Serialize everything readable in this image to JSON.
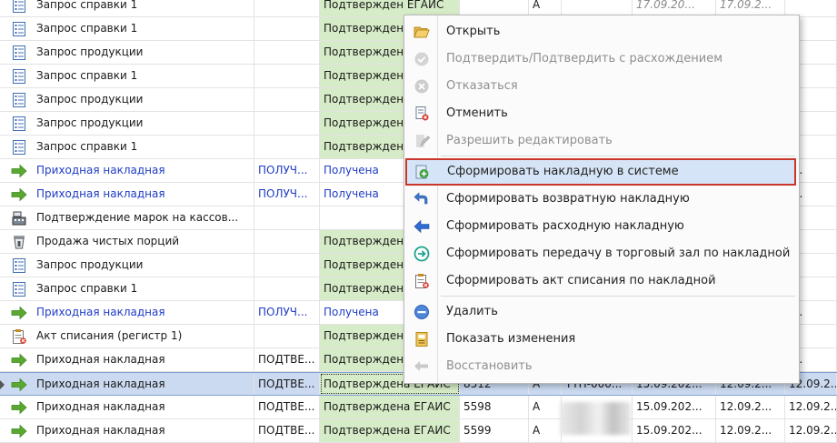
{
  "grid": {
    "rows": [
      {
        "name": "Запрос справки 1",
        "icon": "list-document-icon",
        "blue": false,
        "col_a": "",
        "status": "Подтвержден ЕГАИС",
        "status_green": true,
        "num": "",
        "b": "A",
        "c": "",
        "d1": "17.09.20...",
        "d2": "17.09.2...",
        "d3": "",
        "italic_d1": true
      },
      {
        "name": "Запрос справки 1",
        "icon": "list-document-icon",
        "blue": false,
        "col_a": "",
        "status": "Подтвержден",
        "status_green": true,
        "num": "",
        "b": "",
        "c": "",
        "d1": "",
        "d2": "",
        "d3": ""
      },
      {
        "name": "Запрос продукции",
        "icon": "list-document-icon",
        "blue": false,
        "col_a": "",
        "status": "Подтвержден",
        "status_green": true,
        "num": "",
        "b": "",
        "c": "",
        "d1": "",
        "d2": "",
        "d3": ""
      },
      {
        "name": "Запрос справки 1",
        "icon": "list-document-icon",
        "blue": false,
        "col_a": "",
        "status": "Подтвержден",
        "status_green": true,
        "num": "",
        "b": "",
        "c": "",
        "d1": "",
        "d2": "",
        "d3": ""
      },
      {
        "name": "Запрос продукции",
        "icon": "list-document-icon",
        "blue": false,
        "col_a": "",
        "status": "Подтвержден",
        "status_green": true,
        "num": "",
        "b": "",
        "c": "",
        "d1": "",
        "d2": "",
        "d3": ""
      },
      {
        "name": "Запрос продукции",
        "icon": "list-document-icon",
        "blue": false,
        "col_a": "",
        "status": "Подтвержден",
        "status_green": true,
        "num": "",
        "b": "",
        "c": "",
        "d1": "",
        "d2": "",
        "d3": ""
      },
      {
        "name": "Запрос справки 1",
        "icon": "list-document-icon",
        "blue": false,
        "col_a": "",
        "status": "Подтвержден",
        "status_green": true,
        "num": "",
        "b": "",
        "c": "",
        "d1": "",
        "d2": "",
        "d3": ""
      },
      {
        "name": "Приходная накладная",
        "icon": "green-arrow-icon",
        "blue": true,
        "col_a": "ПОЛУЧ...",
        "status": "Получена",
        "status_green": false,
        "num": "",
        "b": "",
        "c": "",
        "d1": "",
        "d2": "",
        "d3": ".2."
      },
      {
        "name": "Приходная накладная",
        "icon": "green-arrow-icon",
        "blue": true,
        "col_a": "ПОЛУЧ...",
        "status": "Получена",
        "status_green": false,
        "num": "",
        "b": "",
        "c": "",
        "d1": "",
        "d2": "",
        "d3": ".2."
      },
      {
        "name": "Подтверждение марок на кассов...",
        "icon": "cash-register-icon",
        "blue": false,
        "col_a": "",
        "status": "",
        "status_green": false,
        "num": "",
        "b": "",
        "c": "",
        "d1": "",
        "d2": "",
        "d3": ""
      },
      {
        "name": "Продажа чистых порций",
        "icon": "glass-icon",
        "blue": false,
        "col_a": "",
        "status": "Подтвержден",
        "status_green": true,
        "num": "",
        "b": "",
        "c": "",
        "d1": "",
        "d2": "",
        "d3": ""
      },
      {
        "name": "Запрос продукции",
        "icon": "list-document-icon",
        "blue": false,
        "col_a": "",
        "status": "Подтвержден",
        "status_green": true,
        "num": "",
        "b": "",
        "c": "",
        "d1": "",
        "d2": "",
        "d3": ""
      },
      {
        "name": "Запрос справки 1",
        "icon": "list-document-icon",
        "blue": false,
        "col_a": "",
        "status": "Подтвержден",
        "status_green": true,
        "num": "",
        "b": "",
        "c": "",
        "d1": "",
        "d2": "",
        "d3": ""
      },
      {
        "name": "Приходная накладная",
        "icon": "green-arrow-icon",
        "blue": true,
        "col_a": "ПОЛУЧ...",
        "status": "Получена",
        "status_green": false,
        "num": "",
        "b": "",
        "c": "",
        "d1": "",
        "d2": "",
        "d3": ".2."
      },
      {
        "name": "Акт списания (регистр 1)",
        "icon": "write-off-act-icon",
        "blue": false,
        "col_a": "",
        "status": "Подтвержден",
        "status_green": true,
        "num": "",
        "b": "",
        "c": "",
        "d1": "",
        "d2": "",
        "d3": ""
      },
      {
        "name": "Приходная накладная",
        "icon": "green-arrow-icon",
        "blue": false,
        "col_a": "ПОДТВЕ...",
        "status": "Подтвержден",
        "status_green": true,
        "num": "",
        "b": "",
        "c": "",
        "d1": "",
        "d2": "",
        "d3": ".2."
      },
      {
        "name": "Приходная накладная",
        "icon": "green-arrow-icon",
        "blue": false,
        "col_a": "ПОДТВЕ...",
        "status": "Подтверждена ЕГАИС",
        "status_green": true,
        "num": "8512",
        "b": "A",
        "c": "ТТН-000...",
        "d1": "15.09.202...",
        "d2": "12.09.2...",
        "d3": "12.09.2...",
        "selected": true
      },
      {
        "name": "Приходная накладная",
        "icon": "green-arrow-icon",
        "blue": false,
        "col_a": "ПОДТВЕ...",
        "status": "Подтверждена ЕГАИС",
        "status_green": true,
        "num": "5598",
        "b": "A",
        "c": "",
        "d1": "15.09.202...",
        "d2": "12.09.2...",
        "d3": "12.09.2..."
      },
      {
        "name": "Приходная накладная",
        "icon": "green-arrow-icon",
        "blue": false,
        "col_a": "ПОДТВЕ...",
        "status": "Подтверждена ЕГАИС",
        "status_green": true,
        "num": "5599",
        "b": "A",
        "c": "",
        "d1": "15.09.202...",
        "d2": "12.09.2...",
        "d3": "12.09.2..."
      }
    ]
  },
  "context_menu": {
    "items": [
      {
        "label": "Открыть",
        "icon": "folder-open-icon",
        "enabled": true,
        "highlight": false
      },
      {
        "label": "Подтвердить/Подтвердить с расхождением",
        "icon": "check-circle-icon",
        "enabled": false,
        "highlight": false
      },
      {
        "label": "Отказаться",
        "icon": "cancel-circle-icon",
        "enabled": false,
        "highlight": false
      },
      {
        "label": "Отменить",
        "icon": "cancel-document-icon",
        "enabled": true,
        "highlight": false
      },
      {
        "label": "Разрешить редактировать",
        "icon": "edit-pencil-icon",
        "enabled": false,
        "highlight": false
      },
      {
        "label": "Сформировать накладную в системе",
        "icon": "create-invoice-icon",
        "enabled": true,
        "highlight": true
      },
      {
        "label": "Сформировать возвратную накладную",
        "icon": "return-arrow-icon",
        "enabled": true,
        "highlight": false
      },
      {
        "label": "Сформировать расходную накладную",
        "icon": "outgoing-arrow-icon",
        "enabled": true,
        "highlight": false
      },
      {
        "label": "Сформировать передачу в торговый зал по накладной",
        "icon": "transfer-circle-icon",
        "enabled": true,
        "highlight": false
      },
      {
        "label": "Сформировать акт списания по накладной",
        "icon": "write-off-document-icon",
        "enabled": true,
        "highlight": false
      },
      {
        "label": "Удалить",
        "icon": "delete-minus-icon",
        "enabled": true,
        "highlight": false
      },
      {
        "label": "Показать изменения",
        "icon": "history-document-icon",
        "enabled": true,
        "highlight": false
      },
      {
        "label": "Восстановить",
        "icon": "restore-arrow-icon",
        "enabled": false,
        "highlight": false
      }
    ]
  },
  "colors": {
    "status_green_bg": "#d6ebc7",
    "link_blue": "#1f3cc5",
    "selection_bg": "#cbdaf1",
    "menu_highlight_bg": "#d5e5f7",
    "menu_highlight_border": "#c9372c"
  }
}
